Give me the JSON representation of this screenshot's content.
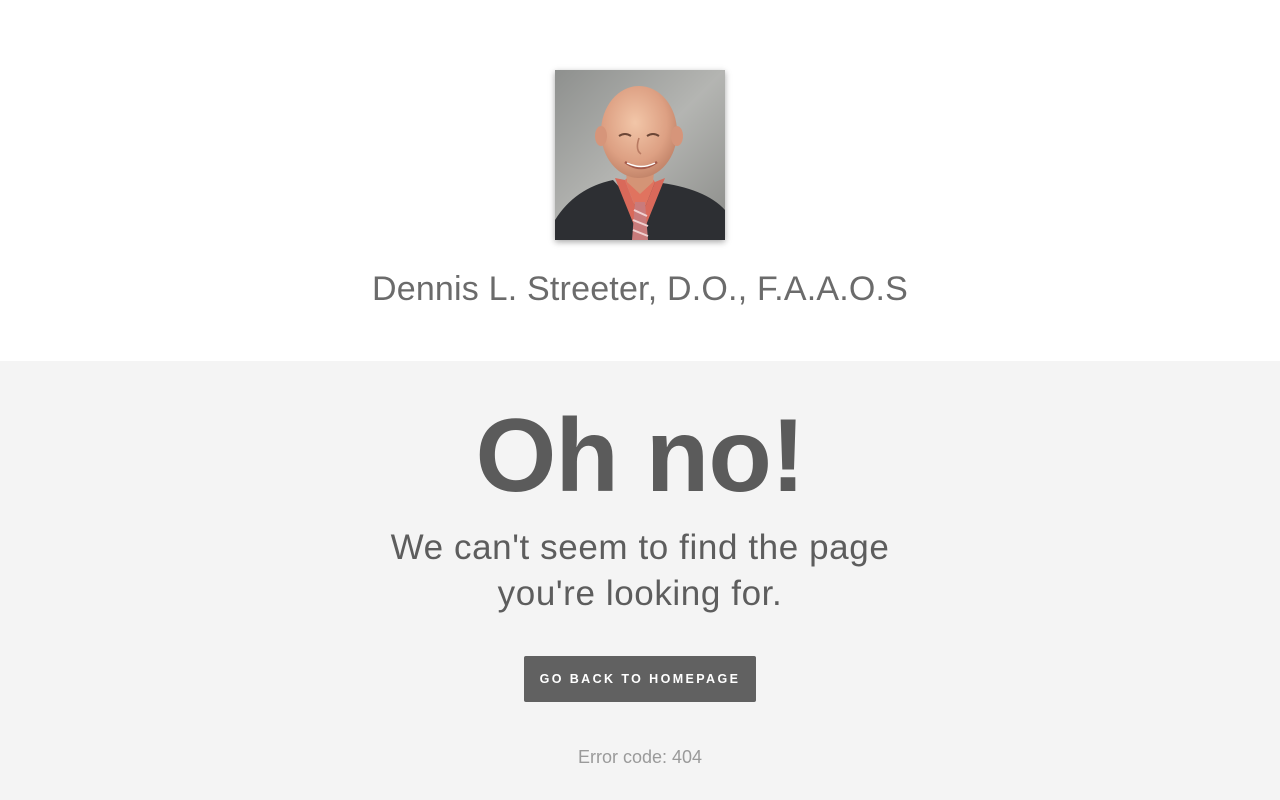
{
  "header": {
    "name": "Dennis L. Streeter, D.O., F.A.A.O.S",
    "avatar_icon": "portrait-photo"
  },
  "error": {
    "headline": "Oh no!",
    "message": "We can't seem to find the page you're looking for.",
    "button_label": "GO BACK TO HOMEPAGE",
    "code_text": "Error code: 404"
  },
  "colors": {
    "top_background": "#ffffff",
    "bottom_background": "#f4f4f4",
    "button_background": "#616161",
    "headline_text": "#5b5b5b"
  }
}
